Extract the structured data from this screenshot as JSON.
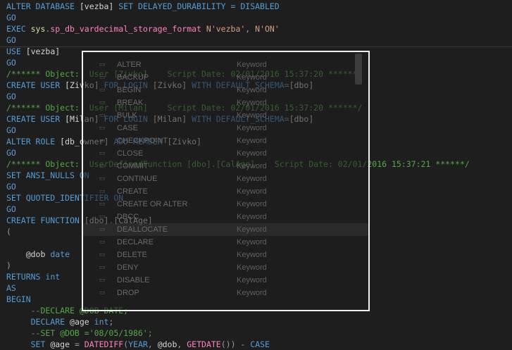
{
  "colors": {
    "background": "#1e1e1e",
    "keyword": "#569cd6",
    "string": "#d69d85",
    "comment": "#57a64a",
    "function": "#ff80c0",
    "system": "#dcdcaa",
    "gray": "#9b9b9b",
    "text": "#d4d4d4"
  },
  "editor": {
    "lines": [
      [
        {
          "t": "ALTER DATABASE ",
          "c": "keyword"
        },
        {
          "t": "[vezba]",
          "c": "text"
        },
        {
          "t": " SET DELAYED_DURABILITY = DISABLED",
          "c": "keyword"
        }
      ],
      [
        {
          "t": "GO",
          "c": "keyword"
        }
      ],
      [
        {
          "t": "EXEC ",
          "c": "keyword"
        },
        {
          "t": "sys",
          "c": "system"
        },
        {
          "t": ".",
          "c": "gray"
        },
        {
          "t": "sp_db_vardecimal_storage_format",
          "c": "function"
        },
        {
          "t": " N'vezba'",
          "c": "string"
        },
        {
          "t": ", ",
          "c": "gray"
        },
        {
          "t": "N'ON'",
          "c": "string"
        }
      ],
      [
        {
          "t": "GO",
          "c": "keyword"
        }
      ],
      [
        {
          "t": "USE ",
          "c": "keyword"
        },
        {
          "t": "[vezba]",
          "c": "text"
        }
      ],
      [
        {
          "t": "GO",
          "c": "keyword"
        }
      ],
      [
        {
          "t": "/****** Object:  User [Zivko]    Script Date: 02/01/2016 15:37:20 ******/",
          "c": "comment"
        }
      ],
      [
        {
          "t": "CREATE USER ",
          "c": "keyword"
        },
        {
          "t": "[Zivko]",
          "c": "text"
        },
        {
          "t": " FOR LOGIN ",
          "c": "keyword"
        },
        {
          "t": "[Zivko]",
          "c": "text"
        },
        {
          "t": " WITH DEFAULT_SCHEMA",
          "c": "keyword"
        },
        {
          "t": "=",
          "c": "gray"
        },
        {
          "t": "[dbo]",
          "c": "text"
        }
      ],
      [
        {
          "t": "GO",
          "c": "keyword"
        }
      ],
      [
        {
          "t": "/****** Object:  User [Milan]    Script Date: 02/01/2016 15:37:20 ******/",
          "c": "comment"
        }
      ],
      [
        {
          "t": "CREATE USER ",
          "c": "keyword"
        },
        {
          "t": "[Milan]",
          "c": "text"
        },
        {
          "t": " FOR LOGIN ",
          "c": "keyword"
        },
        {
          "t": "[Milan]",
          "c": "text"
        },
        {
          "t": " WITH DEFAULT_SCHEMA",
          "c": "keyword"
        },
        {
          "t": "=",
          "c": "gray"
        },
        {
          "t": "[dbo]",
          "c": "text"
        }
      ],
      [
        {
          "t": "GO",
          "c": "keyword"
        }
      ],
      [
        {
          "t": "ALTER ROLE ",
          "c": "keyword"
        },
        {
          "t": "[db_owner]",
          "c": "text"
        },
        {
          "t": " ADD MEMBER ",
          "c": "keyword"
        },
        {
          "t": "[Zivko]",
          "c": "text"
        }
      ],
      [
        {
          "t": "GO",
          "c": "keyword"
        }
      ],
      [
        {
          "t": "/****** Object:  UserDefinedFunction [dbo].[CalAge]    Script Date: 02/01/2016 15:37:21 ******/",
          "c": "comment"
        }
      ],
      [
        {
          "t": "SET ANSI_NULLS ON",
          "c": "keyword"
        }
      ],
      [
        {
          "t": "GO",
          "c": "keyword"
        }
      ],
      [
        {
          "t": "SET QUOTED_IDENTIFIER ON",
          "c": "keyword"
        }
      ],
      [
        {
          "t": "GO",
          "c": "keyword"
        }
      ],
      [
        {
          "t": "CREATE FUNCTION ",
          "c": "keyword"
        },
        {
          "t": "[dbo]",
          "c": "text"
        },
        {
          "t": ".",
          "c": "gray"
        },
        {
          "t": "[CalAge]",
          "c": "text"
        }
      ],
      [
        {
          "t": "(",
          "c": "gray"
        }
      ],
      [
        {
          "t": "",
          "c": "text"
        }
      ],
      [
        {
          "t": "    @dob ",
          "c": "text"
        },
        {
          "t": "date",
          "c": "keyword"
        }
      ],
      [
        {
          "t": ")",
          "c": "gray"
        }
      ],
      [
        {
          "t": "RETURNS ",
          "c": "keyword"
        },
        {
          "t": "int",
          "c": "keyword"
        }
      ],
      [
        {
          "t": "AS",
          "c": "keyword"
        }
      ],
      [
        {
          "t": "BEGIN",
          "c": "keyword"
        }
      ],
      [
        {
          "t": "     --DECLARE @DOB DATE;",
          "c": "comment"
        }
      ],
      [
        {
          "t": "     DECLARE ",
          "c": "keyword"
        },
        {
          "t": "@age ",
          "c": "text"
        },
        {
          "t": "int",
          "c": "keyword"
        },
        {
          "t": ";",
          "c": "gray"
        }
      ],
      [
        {
          "t": "     --SET @DOB ='08/05/1986';",
          "c": "comment"
        }
      ],
      [
        {
          "t": "     SET ",
          "c": "keyword"
        },
        {
          "t": "@age ",
          "c": "text"
        },
        {
          "t": "= ",
          "c": "gray"
        },
        {
          "t": "DATEDIFF",
          "c": "function"
        },
        {
          "t": "(",
          "c": "gray"
        },
        {
          "t": "YEAR",
          "c": "keyword"
        },
        {
          "t": ", ",
          "c": "gray"
        },
        {
          "t": "@dob",
          "c": "text"
        },
        {
          "t": ", ",
          "c": "gray"
        },
        {
          "t": "GETDATE",
          "c": "function"
        },
        {
          "t": "()) ",
          "c": "gray"
        },
        {
          "t": "- ",
          "c": "gray"
        },
        {
          "t": "CASE",
          "c": "keyword"
        }
      ]
    ]
  },
  "completion": {
    "selected_index": 13,
    "items": [
      {
        "icon": "keyword-icon",
        "glyph": "▭",
        "label": "ALTER",
        "type": "Keyword"
      },
      {
        "icon": "keyword-icon",
        "glyph": "▭",
        "label": "BACKUP",
        "type": "Keyword"
      },
      {
        "icon": "keyword-icon",
        "glyph": "▭",
        "label": "BEGIN",
        "type": "Keyword"
      },
      {
        "icon": "keyword-icon",
        "glyph": "▭",
        "label": "BREAK",
        "type": "Keyword"
      },
      {
        "icon": "keyword-icon",
        "glyph": "▭",
        "label": "BULK",
        "type": "Keyword"
      },
      {
        "icon": "keyword-icon",
        "glyph": "▭",
        "label": "CASE",
        "type": "Keyword"
      },
      {
        "icon": "keyword-icon",
        "glyph": "▭",
        "label": "CHECKPOINT",
        "type": "Keyword"
      },
      {
        "icon": "keyword-icon",
        "glyph": "▭",
        "label": "CLOSE",
        "type": "Keyword"
      },
      {
        "icon": "keyword-icon",
        "glyph": "▭",
        "label": "COMMIT",
        "type": "Keyword"
      },
      {
        "icon": "keyword-icon",
        "glyph": "▭",
        "label": "CONTINUE",
        "type": "Keyword"
      },
      {
        "icon": "keyword-icon",
        "glyph": "▭",
        "label": "CREATE",
        "type": "Keyword"
      },
      {
        "icon": "keyword-icon",
        "glyph": "▭",
        "label": "CREATE OR ALTER",
        "type": "Keyword"
      },
      {
        "icon": "keyword-icon",
        "glyph": "▭",
        "label": "DBCC",
        "type": "Keyword"
      },
      {
        "icon": "keyword-icon",
        "glyph": "▭",
        "label": "DEALLOCATE",
        "type": "Keyword"
      },
      {
        "icon": "keyword-icon",
        "glyph": "▭",
        "label": "DECLARE",
        "type": "Keyword"
      },
      {
        "icon": "keyword-icon",
        "glyph": "▭",
        "label": "DELETE",
        "type": "Keyword"
      },
      {
        "icon": "keyword-icon",
        "glyph": "▭",
        "label": "DENY",
        "type": "Keyword"
      },
      {
        "icon": "keyword-icon",
        "glyph": "▭",
        "label": "DISABLE",
        "type": "Keyword"
      },
      {
        "icon": "keyword-icon",
        "glyph": "▭",
        "label": "DROP",
        "type": "Keyword"
      }
    ]
  }
}
